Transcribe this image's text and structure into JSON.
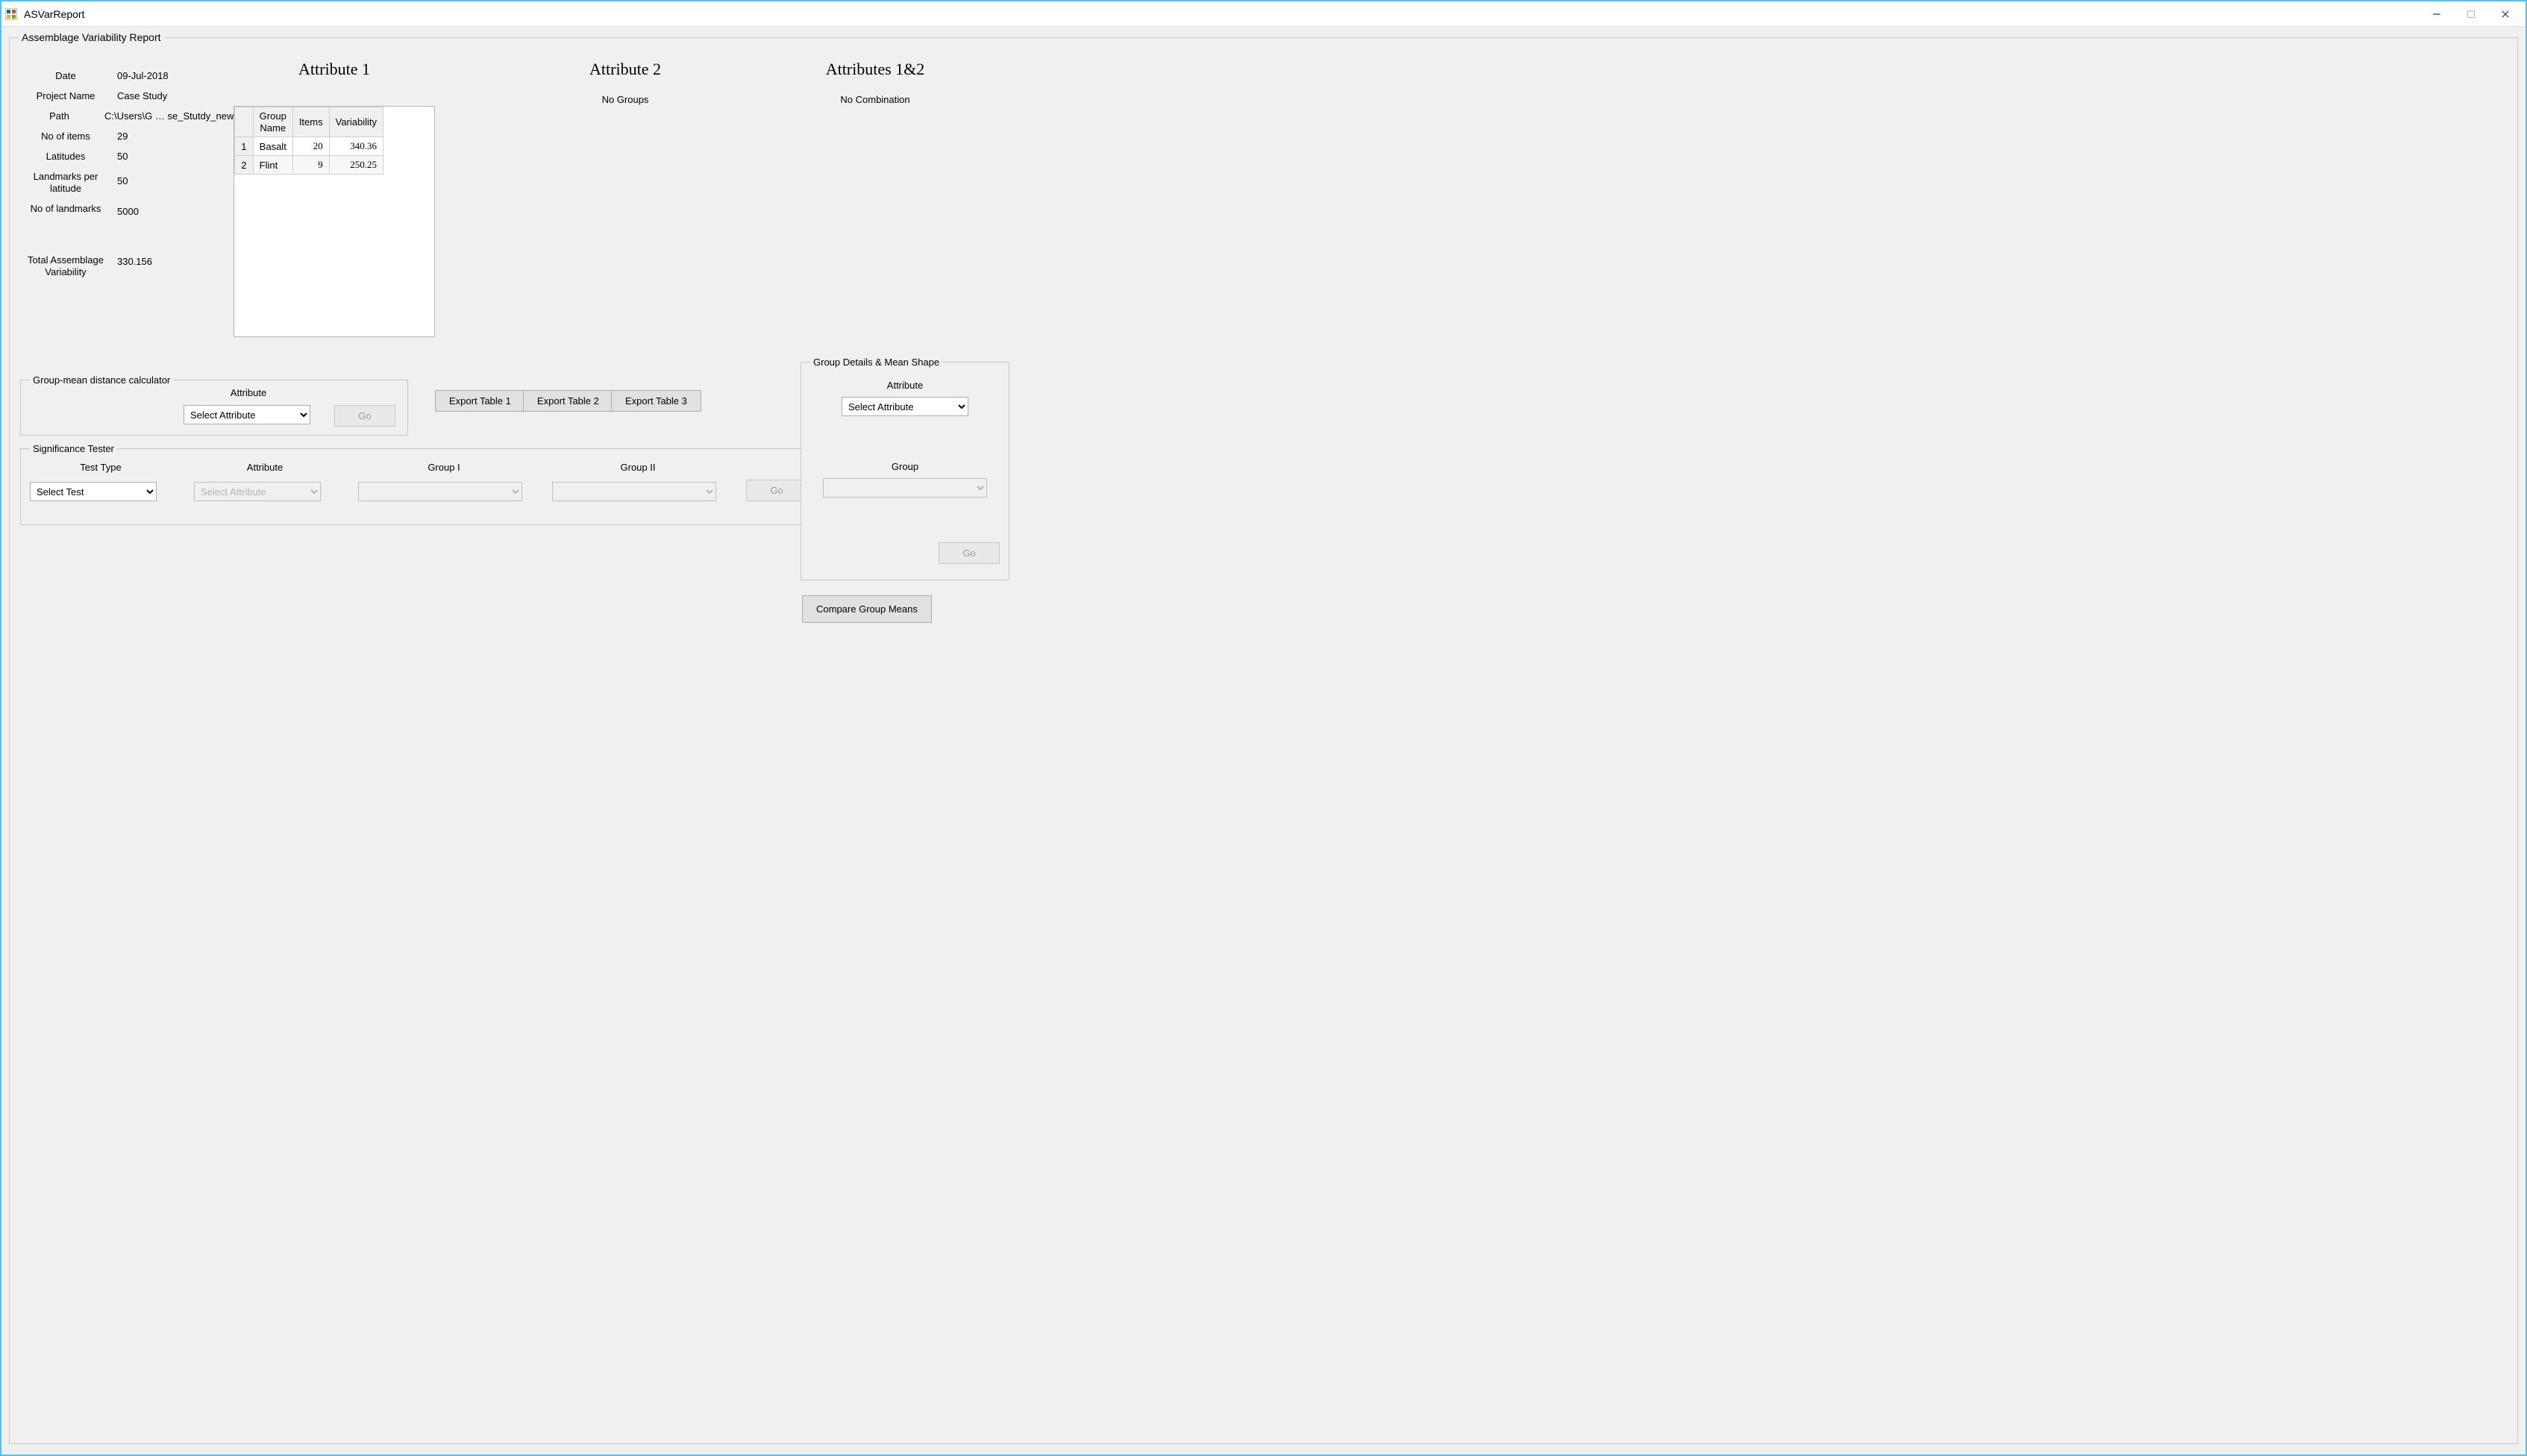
{
  "window": {
    "title": "ASVarReport"
  },
  "report": {
    "legend": "Assemblage Variability Report",
    "meta": {
      "date_label": "Date",
      "date": "09-Jul-2018",
      "project_label": "Project Name",
      "project": "Case Study",
      "path_label": "Path",
      "path": "C:\\Users\\G … se_Stutdy_new\\",
      "items_label": "No of items",
      "items": "29",
      "lat_label": "Latitudes",
      "lat": "50",
      "lpl_label": "Landmarks per latitude",
      "lpl": "50",
      "lmk_label": "No of landmarks",
      "lmk": "5000",
      "tav_label": "Total Assemblage Variability",
      "tav": "330.156"
    },
    "attr1": {
      "title": "Attribute 1",
      "headers": {
        "group": "Group Name",
        "items": "Items",
        "var": "Variability"
      },
      "rows": [
        {
          "idx": "1",
          "name": "Basalt",
          "items": "20",
          "var": "340.36"
        },
        {
          "idx": "2",
          "name": "Flint",
          "items": "9",
          "var": "250.25"
        }
      ]
    },
    "attr2": {
      "title": "Attribute 2",
      "msg": "No Groups"
    },
    "attr12": {
      "title": "Attributes 1&2",
      "msg": "No Combination"
    }
  },
  "export": {
    "t1": "Export Table 1",
    "t2": "Export Table 2",
    "t3": "Export Table 3"
  },
  "gmdc": {
    "legend": "Group-mean distance calculator",
    "attr_label": "Attribute",
    "attr_placeholder": "Select Attribute",
    "go": "Go"
  },
  "sig": {
    "legend": "Significance Tester",
    "test_label": "Test Type",
    "test_placeholder": "Select Test",
    "attr_label": "Attribute",
    "attr_placeholder": "Select Attribute",
    "g1_label": "Group I",
    "g2_label": "Group II",
    "go": "Go"
  },
  "details": {
    "legend": "Group Details & Mean Shape",
    "attr_label": "Attribute",
    "attr_placeholder": "Select Attribute",
    "group_label": "Group",
    "go": "Go"
  },
  "compare": {
    "label": "Compare Group Means"
  }
}
